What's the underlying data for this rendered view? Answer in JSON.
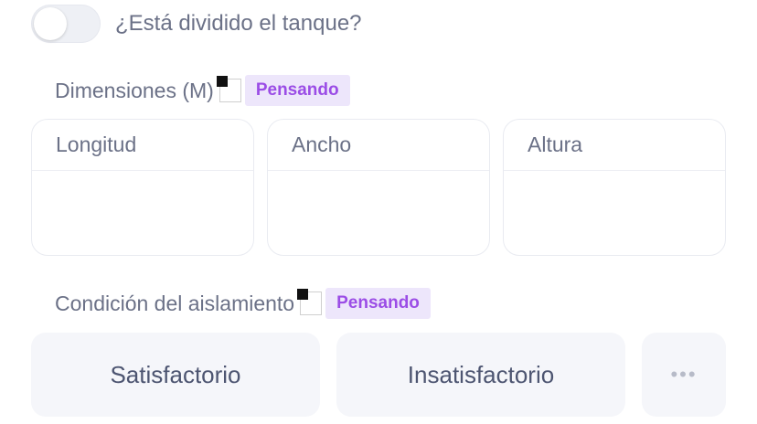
{
  "divided_tank": {
    "label": "¿Está dividido el tanque?",
    "enabled": false
  },
  "dimensions": {
    "label": "Dimensiones (M)",
    "status_badge": "Pensando",
    "fields": [
      {
        "label": "Longitud",
        "value": ""
      },
      {
        "label": "Ancho",
        "value": ""
      },
      {
        "label": "Altura",
        "value": ""
      }
    ]
  },
  "insulation": {
    "label": "Condición del aislamiento",
    "status_badge": "Pensando",
    "options": [
      "Satisfactorio",
      "Insatisfactorio"
    ],
    "more_label": "•••"
  },
  "colors": {
    "badge_bg": "#ede6fb",
    "badge_text": "#9b4de6",
    "option_bg": "#f5f6fa"
  }
}
